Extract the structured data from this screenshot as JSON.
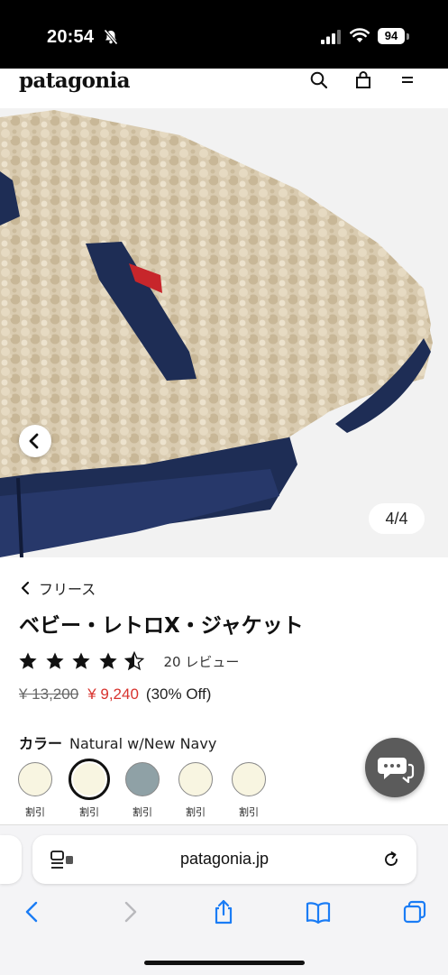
{
  "status_bar": {
    "time": "20:54",
    "battery": "94"
  },
  "header": {
    "logo": "patagonia"
  },
  "carousel": {
    "counter": "4/4"
  },
  "product": {
    "breadcrumb": "フリース",
    "title": "ベビー・レトロX・ジャケット",
    "rating": 4.5,
    "review_count": "20 レビュー",
    "old_price": "¥ 13,200",
    "new_price": "¥ 9,240",
    "discount": "(30% Off)",
    "color_label": "カラー",
    "color_name": "Natural w/New Navy",
    "swatches": [
      {
        "color": "#f8f5e1",
        "label": "割引"
      },
      {
        "color": "#f8f5e1",
        "label": "割引"
      },
      {
        "color": "#8fa1a6",
        "label": "割引"
      },
      {
        "color": "#f8f5e1",
        "label": "割引"
      },
      {
        "color": "#f8f5e1",
        "label": "割引"
      }
    ]
  },
  "browser": {
    "url": "patagonia.jp"
  },
  "colors": {
    "price_red": "#d8332e",
    "link_blue": "#1a7cf5",
    "navy": "#1e2d55",
    "fleece": "#d9cbb0"
  }
}
